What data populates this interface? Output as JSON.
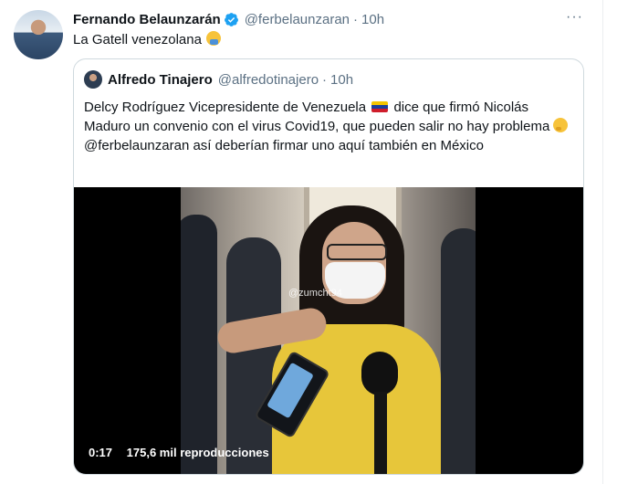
{
  "tweet": {
    "author_name": "Fernando Belaunzarán",
    "author_handle": "@ferbelaunzaran",
    "separator": "·",
    "time": "10h",
    "more": "···",
    "text": "La Gatell venezolana",
    "emoji": "person-facepalming"
  },
  "quoted": {
    "author_name": "Alfredo Tinajero",
    "author_handle": "@alfredotinajero",
    "separator": "·",
    "time": "10h",
    "text_part1": "Delcy Rodríguez Vicepresidente de Venezuela",
    "text_part2": " dice que firmó Nicolás Maduro un convenio con el virus Covid19, que pueden salir no hay problema ",
    "text_part3": "@ferbelaunzaran así deberían firmar uno aquí también en México",
    "flag_emoji": "venezuela-flag",
    "thinking_emoji": "thinking-face"
  },
  "video": {
    "watermark": "@zumcht94",
    "elapsed": "0:17",
    "views": "175,6 mil reproducciones"
  },
  "colors": {
    "verified": "#1da1f2",
    "secondary_text": "#5b7083",
    "border": "#cfd9de"
  }
}
